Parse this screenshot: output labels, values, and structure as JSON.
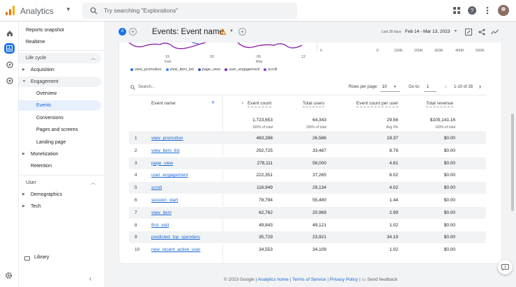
{
  "app": {
    "title": "Analytics",
    "logo_colors": [
      "#f9ab00",
      "#e37400",
      "#e37400"
    ]
  },
  "search": {
    "placeholder": "Try searching \"Explorations\""
  },
  "rail_icons": [
    "home-icon",
    "reports-icon",
    "explore-icon",
    "advertising-icon"
  ],
  "nav": {
    "reports_snapshot": "Reports snapshot",
    "realtime": "Realtime",
    "life_cycle": "Life cycle",
    "acquisition": "Acquisition",
    "engagement": "Engagement",
    "overview": "Overview",
    "events": "Events",
    "conversions": "Conversions",
    "pages_and_screens": "Pages and screens",
    "landing_page": "Landing page",
    "monetization": "Monetization",
    "retention": "Retention",
    "user": "User",
    "demographics": "Demographics",
    "tech": "Tech",
    "library": "Library"
  },
  "header": {
    "comparison_chip": "A",
    "title": "Events: Event name",
    "date_prefix": "Last 28 days",
    "date_range": "Feb 14 - Mar 13, 2023"
  },
  "chart": {
    "x_ticks": [
      {
        "day": "19",
        "month": "Feb"
      },
      {
        "day": "26",
        "month": ""
      },
      {
        "day": "05",
        "month": "Mar"
      },
      {
        "day": "12",
        "month": ""
      }
    ],
    "left_y_zero": "0",
    "bar_ticks": [
      "0",
      "100K",
      "200K",
      "300K",
      "400K",
      "500K"
    ],
    "legend": [
      {
        "name": "view_promotion",
        "color": "#1a73e8"
      },
      {
        "name": "view_item_list",
        "color": "#4285f4"
      },
      {
        "name": "page_view",
        "color": "#3c4fbf"
      },
      {
        "name": "user_engagement",
        "color": "#8e24aa"
      },
      {
        "name": "scroll",
        "color": "#9334e6"
      }
    ]
  },
  "table_controls": {
    "search_placeholder": "Search...",
    "rows_per_page_label": "Rows per page:",
    "rows_per_page_value": "10",
    "goto_label": "Go to:",
    "goto_value": "1",
    "pagination": "1-10 of 28"
  },
  "table": {
    "columns": [
      "Event name",
      "Event count",
      "Total users",
      "Event count per user",
      "Total revenue"
    ],
    "totals": [
      "1,723,653",
      "64,343",
      "29.56",
      "$105,141.16"
    ],
    "subtotals": [
      "100% of total",
      "100% of total",
      "Avg 0%",
      "100% of total"
    ],
    "rows": [
      {
        "idx": "1",
        "name": "view_promotion",
        "count": "483,288",
        "users": "26,586",
        "per_user": "18.37",
        "revenue": "$0.00"
      },
      {
        "idx": "2",
        "name": "view_item_list",
        "count": "292,725",
        "users": "33,487",
        "per_user": "8.79",
        "revenue": "$0.00"
      },
      {
        "idx": "3",
        "name": "page_view",
        "count": "278,111",
        "users": "58,000",
        "per_user": "4.81",
        "revenue": "$0.00"
      },
      {
        "idx": "4",
        "name": "user_engagement",
        "count": "222,351",
        "users": "37,265",
        "per_user": "6.02",
        "revenue": "$0.00"
      },
      {
        "idx": "5",
        "name": "scroll",
        "count": "116,949",
        "users": "29,134",
        "per_user": "4.02",
        "revenue": "$0.00"
      },
      {
        "idx": "6",
        "name": "session_start",
        "count": "78,794",
        "users": "55,480",
        "per_user": "1.44",
        "revenue": "$0.00"
      },
      {
        "idx": "7",
        "name": "view_item",
        "count": "62,762",
        "users": "20,969",
        "per_user": "2.99",
        "revenue": "$0.00"
      },
      {
        "idx": "8",
        "name": "first_visit",
        "count": "49,843",
        "users": "49,121",
        "per_user": "1.02",
        "revenue": "$0.00"
      },
      {
        "idx": "9",
        "name": "predicted_top_spenders",
        "count": "35,729",
        "users": "23,921",
        "per_user": "34.19",
        "revenue": "$0.00"
      },
      {
        "idx": "10",
        "name": "new_recent_active_user",
        "count": "34,553",
        "users": "34,109",
        "per_user": "1.02",
        "revenue": "$0.00"
      }
    ]
  },
  "footer": {
    "copyright": "© 2023 Google |",
    "analytics_home": "Analytics home",
    "sep1": "|",
    "terms": "Terms of Service",
    "sep2": "|",
    "privacy": "Privacy Policy",
    "sep3": "|",
    "feedback": "Send feedback"
  }
}
